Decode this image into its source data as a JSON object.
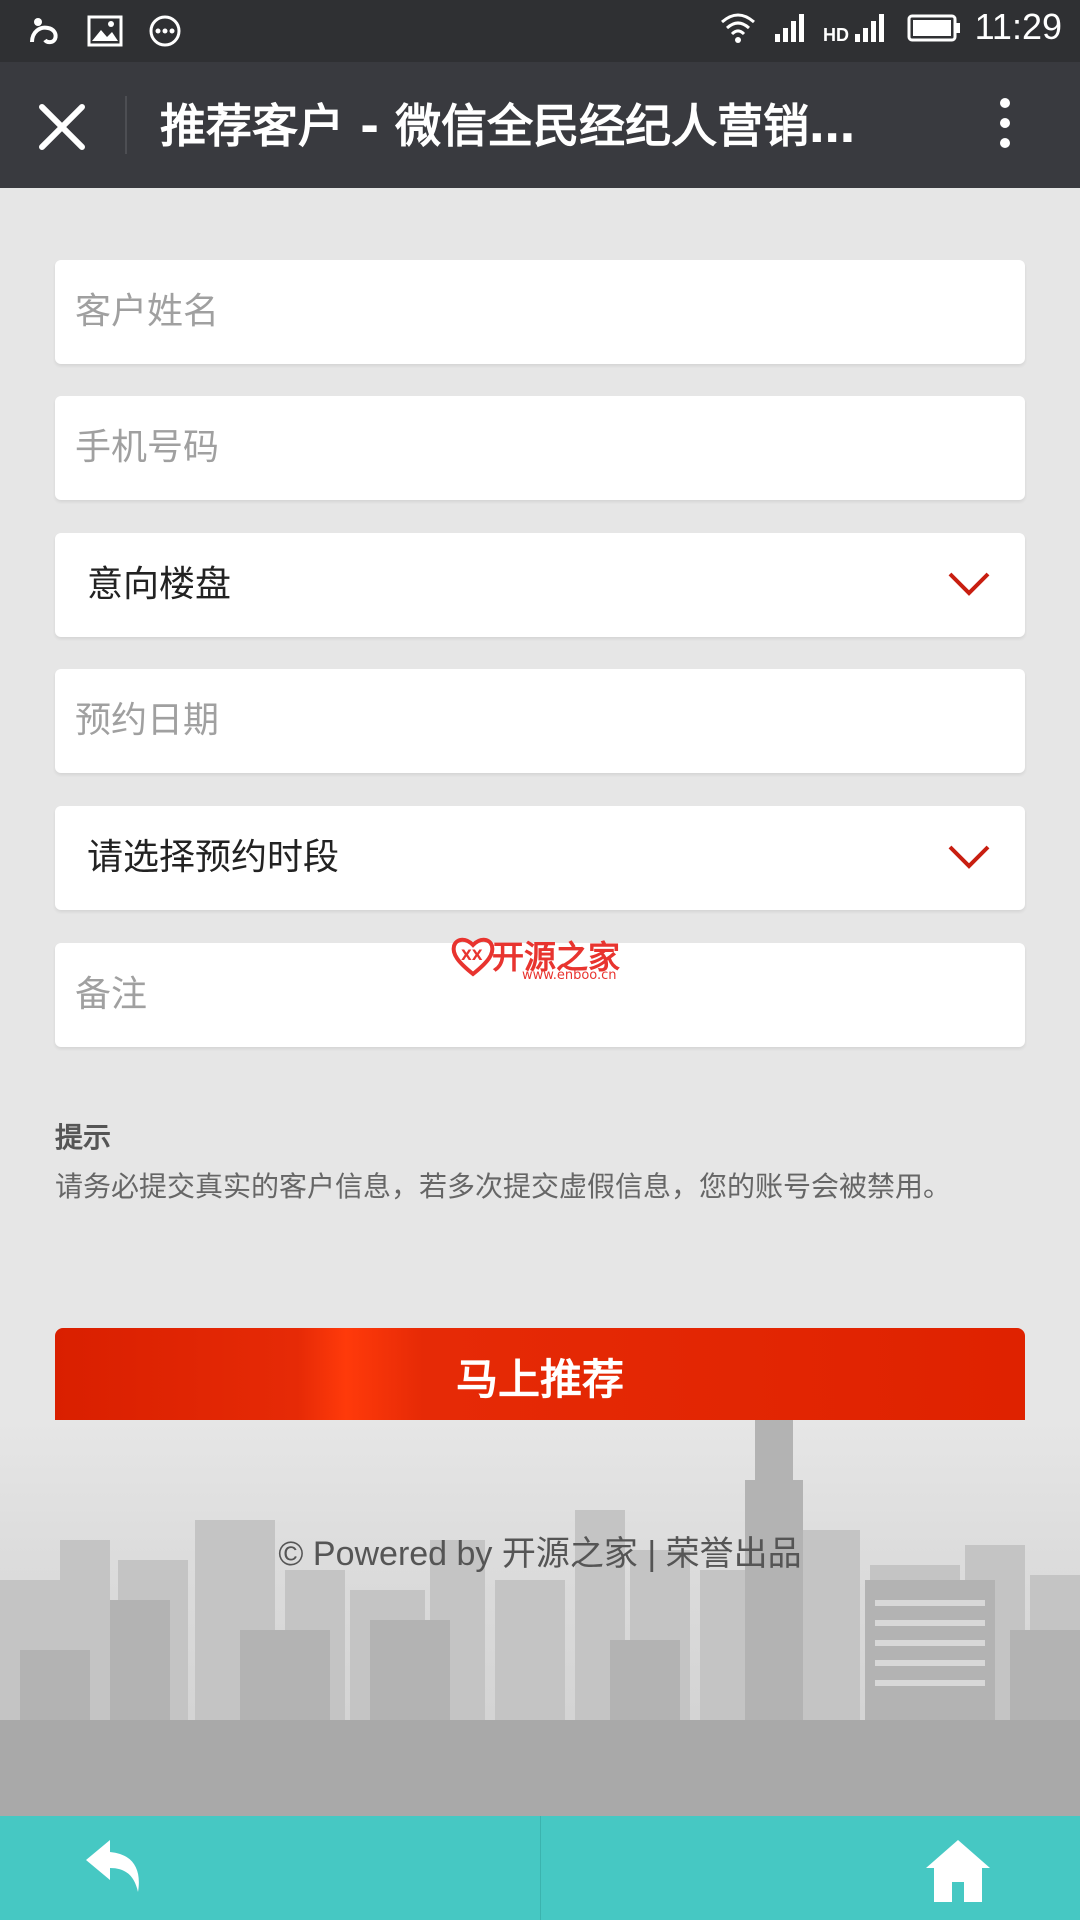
{
  "status_bar": {
    "time": "11:29",
    "icons": [
      "uc-browser-icon",
      "image-icon",
      "chat-bubble-icon",
      "wifi-icon",
      "signal-icon",
      "hd-signal-icon",
      "battery-icon"
    ]
  },
  "title_bar": {
    "title": "推荐客户 - 微信全民经纪人营销系..."
  },
  "form": {
    "customer_name_placeholder": "客户姓名",
    "phone_placeholder": "手机号码",
    "property_select": "意向楼盘",
    "date_placeholder": "预约日期",
    "time_slot_select": "请选择预约时段",
    "remark_placeholder": "备注"
  },
  "watermark": {
    "name": "开源之家",
    "url": "www.enboo.cn"
  },
  "tip": {
    "title": "提示",
    "text": "请务必提交真实的客户信息，若多次提交虚假信息，您的账号会被禁用。"
  },
  "submit_label": "马上推荐",
  "footer_text": "© Powered by 开源之家 | 荣誉出品",
  "colors": {
    "accent": "#e22a05",
    "titlebar": "#393a3f",
    "bottombar": "#46c8c3",
    "chevron": "#c81e10"
  }
}
